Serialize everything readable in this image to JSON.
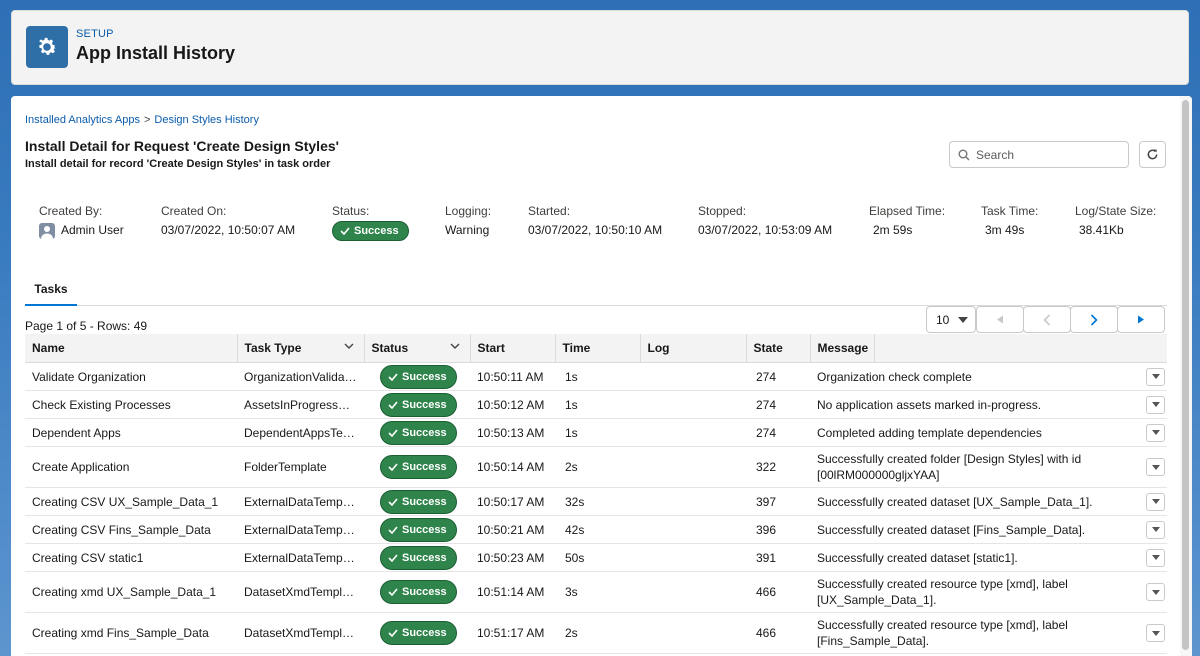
{
  "header": {
    "eyebrow": "SETUP",
    "title": "App Install History",
    "icon": "gear-icon"
  },
  "breadcrumb": {
    "items": [
      "Installed Analytics Apps",
      "Design Styles History"
    ],
    "separator": ">"
  },
  "detail": {
    "title": "Install Detail for Request 'Create Design Styles'",
    "subtitle": "Install detail for record 'Create Design Styles' in task order"
  },
  "search": {
    "placeholder": "Search",
    "value": ""
  },
  "meta": {
    "created_by": {
      "label": "Created By:",
      "value": "Admin User"
    },
    "created_on": {
      "label": "Created On:",
      "value": "03/07/2022, 10:50:07 AM"
    },
    "status": {
      "label": "Status:",
      "value": "Success"
    },
    "logging": {
      "label": "Logging:",
      "value": "Warning"
    },
    "started": {
      "label": "Started:",
      "value": "03/07/2022, 10:50:10 AM"
    },
    "stopped": {
      "label": "Stopped:",
      "value": "03/07/2022, 10:53:09 AM"
    },
    "elapsed": {
      "label": "Elapsed Time:",
      "value": "2m 59s"
    },
    "task_time": {
      "label": "Task Time:",
      "value": "3m 49s"
    },
    "log_size": {
      "label": "Log/State Size:",
      "value": "38.41Kb"
    }
  },
  "tabs": [
    {
      "label": "Tasks",
      "active": true
    }
  ],
  "pagination": {
    "info": "Page 1 of 5 - Rows: 49",
    "page_size": "10"
  },
  "table": {
    "columns": [
      "Name",
      "Task Type",
      "Status",
      "Start",
      "Time",
      "Log",
      "State",
      "Message"
    ],
    "rows": [
      {
        "name": "Validate Organization",
        "type": "OrganizationValidati...",
        "status": "Success",
        "start": "10:50:11 AM",
        "time": "1s",
        "log": "",
        "state": "274",
        "message": "Organization check complete"
      },
      {
        "name": "Check Existing Processes",
        "type": "AssetsInProgressVal...",
        "status": "Success",
        "start": "10:50:12 AM",
        "time": "1s",
        "log": "",
        "state": "274",
        "message": "No application assets marked in-progress."
      },
      {
        "name": "Dependent Apps",
        "type": "DependentAppsTem...",
        "status": "Success",
        "start": "10:50:13 AM",
        "time": "1s",
        "log": "",
        "state": "274",
        "message": "Completed adding template dependencies"
      },
      {
        "name": "Create Application",
        "type": "FolderTemplate",
        "status": "Success",
        "start": "10:50:14 AM",
        "time": "2s",
        "log": "",
        "state": "322",
        "message": "Successfully created folder [Design Styles] with id [00lRM000000gljxYAA]"
      },
      {
        "name": "Creating CSV UX_Sample_Data_1",
        "type": "ExternalDataTemplate",
        "status": "Success",
        "start": "10:50:17 AM",
        "time": "32s",
        "log": "",
        "state": "397",
        "message": "Successfully created dataset [UX_Sample_Data_1]."
      },
      {
        "name": "Creating CSV Fins_Sample_Data",
        "type": "ExternalDataTemplate",
        "status": "Success",
        "start": "10:50:21 AM",
        "time": "42s",
        "log": "",
        "state": "396",
        "message": "Successfully created dataset [Fins_Sample_Data]."
      },
      {
        "name": "Creating CSV static1",
        "type": "ExternalDataTemplate",
        "status": "Success",
        "start": "10:50:23 AM",
        "time": "50s",
        "log": "",
        "state": "391",
        "message": "Successfully created dataset [static1]."
      },
      {
        "name": "Creating xmd UX_Sample_Data_1",
        "type": "DatasetXmdTemplate",
        "status": "Success",
        "start": "10:51:14 AM",
        "time": "3s",
        "log": "",
        "state": "466",
        "message": "Successfully created resource type [xmd], label [UX_Sample_Data_1]."
      },
      {
        "name": "Creating xmd Fins_Sample_Data",
        "type": "DatasetXmdTemplate",
        "status": "Success",
        "start": "10:51:17 AM",
        "time": "2s",
        "log": "",
        "state": "466",
        "message": "Successfully created resource type [xmd], label [Fins_Sample_Data]."
      }
    ]
  },
  "colors": {
    "brand": "#0176d3",
    "success": "#2e844a",
    "header_icon_bg": "#2f6fa8",
    "link": "#0b5cab"
  }
}
